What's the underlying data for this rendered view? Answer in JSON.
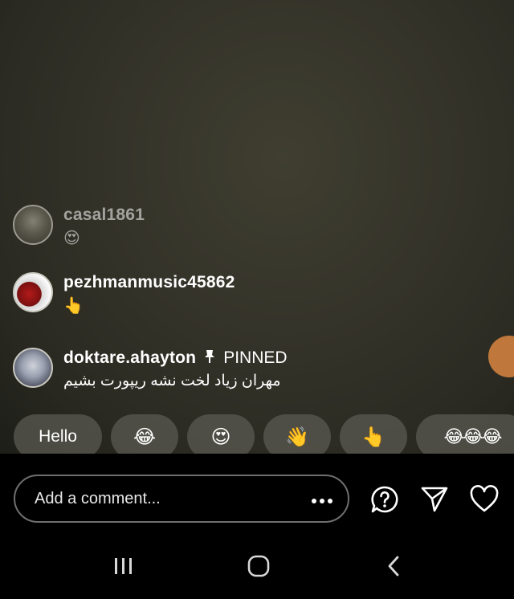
{
  "comments": [
    {
      "username": "casal1861",
      "content": "😍",
      "faded": true
    },
    {
      "username": "pezhmanmusic45862",
      "content": "👆"
    },
    {
      "username": "doktare.ahayton",
      "pinned_label": "PINNED",
      "content": "مهران زیاد لخت نشه ریپورت بشیم"
    }
  ],
  "quick_reactions": [
    "Hello",
    "😂",
    "😍",
    "👋",
    "👆",
    "😂😂😂"
  ],
  "comment_input": {
    "placeholder": "Add a comment..."
  },
  "icons": {
    "more": "more-horizontal-icon",
    "question": "question-circle-icon",
    "send": "send-icon",
    "like": "heart-icon",
    "nav_recent": "recent-apps-icon",
    "nav_home": "home-icon",
    "nav_back": "back-icon"
  },
  "colors": {
    "video_bg": "#35342a",
    "accent_orange": "#d9853f",
    "chip_bg": "#5a5a52"
  }
}
